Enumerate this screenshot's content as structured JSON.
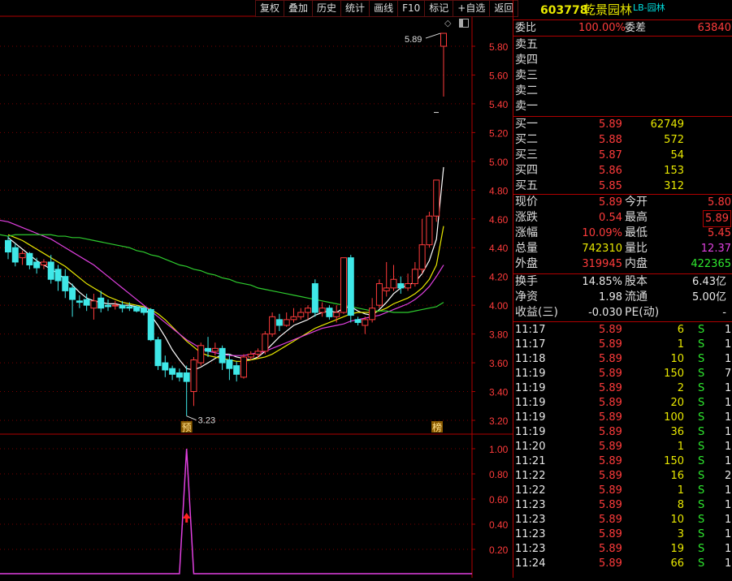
{
  "toolbar": [
    "复权",
    "叠加",
    "历史",
    "统计",
    "画线",
    "F10",
    "标记",
    "+自选",
    "返回"
  ],
  "chart_data": {
    "type": "candlestick",
    "price_axis": {
      "ticks": [
        "5.80",
        "5.60",
        "5.40",
        "5.20",
        "5.00",
        "4.80",
        "4.60",
        "4.40",
        "4.20",
        "4.00",
        "3.80",
        "3.60",
        "3.40",
        "3.20"
      ]
    },
    "indicator_axis": {
      "ticks": [
        "1.00",
        "0.80",
        "0.60",
        "0.40",
        "0.20"
      ]
    },
    "high_label": "5.89",
    "low_label": "3.23",
    "marker_left": "预",
    "marker_right": "榜",
    "candles": [
      {
        "o": 4.45,
        "c": 4.37,
        "h": 4.48,
        "l": 4.32
      },
      {
        "o": 4.4,
        "c": 4.3,
        "h": 4.43,
        "l": 4.27
      },
      {
        "o": 4.33,
        "c": 4.36,
        "h": 4.38,
        "l": 4.28
      },
      {
        "o": 4.36,
        "c": 4.28,
        "h": 4.37,
        "l": 4.25
      },
      {
        "o": 4.3,
        "c": 4.26,
        "h": 4.33,
        "l": 4.22
      },
      {
        "o": 4.28,
        "c": 4.3,
        "h": 4.32,
        "l": 4.25
      },
      {
        "o": 4.3,
        "c": 4.18,
        "h": 4.35,
        "l": 4.15
      },
      {
        "o": 4.25,
        "c": 4.17,
        "h": 4.28,
        "l": 4.1
      },
      {
        "o": 4.2,
        "c": 4.1,
        "h": 4.25,
        "l": 4.05
      },
      {
        "o": 4.12,
        "c": 4.04,
        "h": 4.15,
        "l": 3.92
      },
      {
        "o": 4.03,
        "c": 4.02,
        "h": 4.07,
        "l": 3.98
      },
      {
        "o": 4.04,
        "c": 4.0,
        "h": 4.08,
        "l": 3.96
      },
      {
        "o": 3.98,
        "c": 4.03,
        "h": 4.08,
        "l": 3.9
      },
      {
        "o": 4.05,
        "c": 3.98,
        "h": 4.1,
        "l": 3.95
      },
      {
        "o": 4.0,
        "c": 3.99,
        "h": 4.04,
        "l": 3.96
      },
      {
        "o": 4.0,
        "c": 4.0,
        "h": 4.03,
        "l": 3.97
      },
      {
        "o": 4.0,
        "c": 3.98,
        "h": 4.03,
        "l": 3.95
      },
      {
        "o": 3.99,
        "c": 3.98,
        "h": 4.02,
        "l": 3.96
      },
      {
        "o": 3.99,
        "c": 3.96,
        "h": 4.0,
        "l": 3.95
      },
      {
        "o": 3.98,
        "c": 3.95,
        "h": 3.99,
        "l": 3.93
      },
      {
        "o": 3.97,
        "c": 3.76,
        "h": 3.98,
        "l": 3.75
      },
      {
        "o": 3.76,
        "c": 3.58,
        "h": 3.78,
        "l": 3.55
      },
      {
        "o": 3.6,
        "c": 3.55,
        "h": 3.65,
        "l": 3.5
      },
      {
        "o": 3.56,
        "c": 3.52,
        "h": 3.58,
        "l": 3.48
      },
      {
        "o": 3.53,
        "c": 3.5,
        "h": 3.56,
        "l": 3.47
      },
      {
        "o": 3.53,
        "c": 3.47,
        "h": 3.58,
        "l": 3.23
      },
      {
        "o": 3.4,
        "c": 3.62,
        "h": 3.64,
        "l": 3.3
      },
      {
        "o": 3.6,
        "c": 3.72,
        "h": 3.74,
        "l": 3.58
      },
      {
        "o": 3.7,
        "c": 3.68,
        "h": 3.78,
        "l": 3.64
      },
      {
        "o": 3.68,
        "c": 3.7,
        "h": 3.74,
        "l": 3.65
      },
      {
        "o": 3.7,
        "c": 3.6,
        "h": 3.72,
        "l": 3.55
      },
      {
        "o": 3.62,
        "c": 3.56,
        "h": 3.66,
        "l": 3.48
      },
      {
        "o": 3.58,
        "c": 3.52,
        "h": 3.61,
        "l": 3.47
      },
      {
        "o": 3.5,
        "c": 3.64,
        "h": 3.66,
        "l": 3.49
      },
      {
        "o": 3.64,
        "c": 3.66,
        "h": 3.68,
        "l": 3.62
      },
      {
        "o": 3.66,
        "c": 3.68,
        "h": 3.7,
        "l": 3.63
      },
      {
        "o": 3.68,
        "c": 3.8,
        "h": 3.82,
        "l": 3.66
      },
      {
        "o": 3.8,
        "c": 3.92,
        "h": 3.95,
        "l": 3.78
      },
      {
        "o": 3.9,
        "c": 3.86,
        "h": 3.94,
        "l": 3.82
      },
      {
        "o": 3.86,
        "c": 3.9,
        "h": 3.95,
        "l": 3.85
      },
      {
        "o": 3.9,
        "c": 3.92,
        "h": 3.98,
        "l": 3.88
      },
      {
        "o": 3.92,
        "c": 3.95,
        "h": 3.98,
        "l": 3.9
      },
      {
        "o": 3.95,
        "c": 3.98,
        "h": 4.0,
        "l": 3.9
      },
      {
        "o": 4.15,
        "c": 3.95,
        "h": 4.18,
        "l": 3.92
      },
      {
        "o": 3.95,
        "c": 3.98,
        "h": 4.02,
        "l": 3.92
      },
      {
        "o": 3.98,
        "c": 3.92,
        "h": 4.0,
        "l": 3.9
      },
      {
        "o": 3.92,
        "c": 3.95,
        "h": 4.0,
        "l": 3.88
      },
      {
        "o": 3.95,
        "c": 4.33,
        "h": 4.33,
        "l": 3.94
      },
      {
        "o": 4.33,
        "c": 3.93,
        "h": 4.35,
        "l": 3.88
      },
      {
        "o": 3.9,
        "c": 3.88,
        "h": 3.92,
        "l": 3.86
      },
      {
        "o": 3.86,
        "c": 3.9,
        "h": 3.92,
        "l": 3.8
      },
      {
        "o": 3.9,
        "c": 3.98,
        "h": 4.05,
        "l": 3.88
      },
      {
        "o": 4.0,
        "c": 4.15,
        "h": 4.18,
        "l": 3.98
      },
      {
        "o": 4.1,
        "c": 4.12,
        "h": 4.3,
        "l": 4.06
      },
      {
        "o": 4.12,
        "c": 4.18,
        "h": 4.28,
        "l": 4.1
      },
      {
        "o": 4.15,
        "c": 4.12,
        "h": 4.2,
        "l": 4.08
      },
      {
        "o": 4.12,
        "c": 4.15,
        "h": 4.22,
        "l": 4.1
      },
      {
        "o": 4.15,
        "c": 4.25,
        "h": 4.3,
        "l": 4.13
      },
      {
        "o": 4.25,
        "c": 4.42,
        "h": 4.6,
        "l": 4.22
      },
      {
        "o": 4.42,
        "c": 4.62,
        "h": 4.65,
        "l": 4.4
      },
      {
        "o": 4.62,
        "c": 4.87,
        "h": 4.87,
        "l": 4.58
      },
      {
        "o": 5.8,
        "c": 5.89,
        "h": 5.89,
        "l": 5.45
      }
    ],
    "ma_series": [
      {
        "color": "#ffffff",
        "values": [
          4.47,
          4.43,
          4.39,
          4.35,
          4.31,
          4.28,
          4.25,
          4.22,
          4.18,
          4.14,
          4.09,
          4.05,
          4.03,
          4.02,
          4.01,
          4.01,
          4.0,
          4.0,
          3.99,
          3.98,
          3.93,
          3.86,
          3.78,
          3.69,
          3.62,
          3.56,
          3.55,
          3.57,
          3.6,
          3.63,
          3.66,
          3.66,
          3.64,
          3.63,
          3.62,
          3.64,
          3.68,
          3.73,
          3.78,
          3.82,
          3.86,
          3.88,
          3.9,
          3.93,
          3.95,
          3.96,
          3.95,
          3.98,
          3.99,
          3.96,
          3.94,
          3.93,
          3.97,
          4.02,
          4.08,
          4.12,
          4.14,
          4.16,
          4.22,
          4.31,
          4.46,
          4.96
        ]
      },
      {
        "color": "#e8e800",
        "values": [
          4.49,
          4.47,
          4.45,
          4.42,
          4.39,
          4.36,
          4.33,
          4.3,
          4.27,
          4.23,
          4.19,
          4.15,
          4.12,
          4.09,
          4.06,
          4.04,
          4.02,
          4.01,
          4.0,
          3.99,
          3.97,
          3.94,
          3.9,
          3.85,
          3.8,
          3.75,
          3.71,
          3.67,
          3.65,
          3.64,
          3.63,
          3.62,
          3.61,
          3.61,
          3.62,
          3.63,
          3.64,
          3.66,
          3.69,
          3.72,
          3.75,
          3.78,
          3.81,
          3.84,
          3.86,
          3.88,
          3.9,
          3.92,
          3.94,
          3.95,
          3.95,
          3.95,
          3.96,
          3.98,
          4.01,
          4.03,
          4.05,
          4.08,
          4.12,
          4.18,
          4.28,
          4.55
        ]
      },
      {
        "color": "#e040e0",
        "values": [
          4.58,
          4.56,
          4.54,
          4.52,
          4.5,
          4.48,
          4.46,
          4.43,
          4.4,
          4.37,
          4.34,
          4.31,
          4.28,
          4.24,
          4.2,
          4.16,
          4.12,
          4.08,
          4.04,
          4.0,
          3.96,
          3.92,
          3.88,
          3.84,
          3.8,
          3.76,
          3.73,
          3.7,
          3.68,
          3.67,
          3.66,
          3.65,
          3.65,
          3.65,
          3.66,
          3.67,
          3.68,
          3.7,
          3.72,
          3.74,
          3.76,
          3.78,
          3.8,
          3.82,
          3.84,
          3.85,
          3.86,
          3.87,
          3.89,
          3.9,
          3.91,
          3.92,
          3.93,
          3.95,
          3.97,
          3.99,
          4.01,
          4.04,
          4.08,
          4.13,
          4.2,
          4.28
        ]
      },
      {
        "color": "#2ecc2e",
        "values": [
          4.48,
          4.49,
          4.49,
          4.49,
          4.49,
          4.49,
          4.49,
          4.48,
          4.48,
          4.47,
          4.47,
          4.46,
          4.45,
          4.44,
          4.43,
          4.42,
          4.41,
          4.4,
          4.38,
          4.37,
          4.35,
          4.34,
          4.32,
          4.3,
          4.28,
          4.27,
          4.25,
          4.24,
          4.22,
          4.21,
          4.19,
          4.18,
          4.16,
          4.15,
          4.14,
          4.12,
          4.11,
          4.1,
          4.09,
          4.08,
          4.07,
          4.06,
          4.05,
          4.04,
          4.03,
          4.02,
          4.01,
          4.0,
          3.99,
          3.98,
          3.97,
          3.96,
          3.96,
          3.96,
          3.95,
          3.95,
          3.95,
          3.96,
          3.97,
          3.98,
          3.99,
          4.02
        ]
      }
    ],
    "indicator": {
      "color": "#e040e0",
      "values": [
        0,
        0,
        0,
        0,
        0,
        0,
        0,
        0,
        0,
        0,
        0,
        0,
        0,
        0,
        0,
        0,
        0,
        0,
        0,
        0,
        0,
        0,
        0,
        0,
        0,
        1.0,
        0,
        0,
        0,
        0,
        0,
        0,
        0,
        0,
        0,
        0,
        0,
        0,
        0,
        0,
        0,
        0,
        0,
        0,
        0,
        0,
        0,
        0,
        0,
        0,
        0,
        0,
        0,
        0,
        0,
        0,
        0,
        0,
        0,
        0,
        0,
        0
      ]
    }
  },
  "stock": {
    "code": "603778",
    "name": "乾景园林",
    "tag": "LB-园林"
  },
  "weibi": {
    "label": "委比",
    "value": "100.00%",
    "diff_label": "委差",
    "diff_value": "63840"
  },
  "sell": [
    {
      "label": "卖五",
      "price": "",
      "vol": ""
    },
    {
      "label": "卖四",
      "price": "",
      "vol": ""
    },
    {
      "label": "卖三",
      "price": "",
      "vol": ""
    },
    {
      "label": "卖二",
      "price": "",
      "vol": ""
    },
    {
      "label": "卖一",
      "price": "",
      "vol": ""
    }
  ],
  "buy": [
    {
      "label": "买一",
      "price": "5.89",
      "vol": "62749"
    },
    {
      "label": "买二",
      "price": "5.88",
      "vol": "572"
    },
    {
      "label": "买三",
      "price": "5.87",
      "vol": "54"
    },
    {
      "label": "买四",
      "price": "5.86",
      "vol": "153"
    },
    {
      "label": "买五",
      "price": "5.85",
      "vol": "312"
    }
  ],
  "quote": [
    {
      "l1": "现价",
      "v1": "5.89",
      "c1": "r",
      "l2": "今开",
      "v2": "5.80",
      "c2": "r",
      "box": false
    },
    {
      "l1": "涨跌",
      "v1": "0.54",
      "c1": "r",
      "l2": "最高",
      "v2": "5.89",
      "c2": "r",
      "box": true
    },
    {
      "l1": "涨幅",
      "v1": "10.09%",
      "c1": "r",
      "l2": "最低",
      "v2": "5.45",
      "c2": "r",
      "box": false
    },
    {
      "l1": "总量",
      "v1": "742310",
      "c1": "y",
      "l2": "量比",
      "v2": "12.37",
      "c2": "m",
      "box": false
    },
    {
      "l1": "外盘",
      "v1": "319945",
      "c1": "r",
      "l2": "内盘",
      "v2": "422365",
      "c2": "g",
      "box": false
    }
  ],
  "fund": [
    {
      "l1": "换手",
      "v1": "14.85%",
      "l2": "股本",
      "v2": "6.43亿"
    },
    {
      "l1": "净资",
      "v1": "1.98",
      "l2": "流通",
      "v2": "5.00亿"
    },
    {
      "l1": "收益(三)",
      "v1": "-0.030",
      "l2": "PE(动)",
      "v2": "-"
    }
  ],
  "ticks": [
    {
      "t": "11:17",
      "p": "5.89",
      "v": "6",
      "s": "S",
      "n": "1"
    },
    {
      "t": "11:17",
      "p": "5.89",
      "v": "1",
      "s": "S",
      "n": "1"
    },
    {
      "t": "11:18",
      "p": "5.89",
      "v": "10",
      "s": "S",
      "n": "1"
    },
    {
      "t": "11:19",
      "p": "5.89",
      "v": "150",
      "s": "S",
      "n": "7"
    },
    {
      "t": "11:19",
      "p": "5.89",
      "v": "2",
      "s": "S",
      "n": "1"
    },
    {
      "t": "11:19",
      "p": "5.89",
      "v": "20",
      "s": "S",
      "n": "1"
    },
    {
      "t": "11:19",
      "p": "5.89",
      "v": "100",
      "s": "S",
      "n": "1"
    },
    {
      "t": "11:19",
      "p": "5.89",
      "v": "36",
      "s": "S",
      "n": "1"
    },
    {
      "t": "11:20",
      "p": "5.89",
      "v": "1",
      "s": "S",
      "n": "1"
    },
    {
      "t": "11:21",
      "p": "5.89",
      "v": "150",
      "s": "S",
      "n": "1"
    },
    {
      "t": "11:22",
      "p": "5.89",
      "v": "16",
      "s": "S",
      "n": "2"
    },
    {
      "t": "11:22",
      "p": "5.89",
      "v": "1",
      "s": "S",
      "n": "1"
    },
    {
      "t": "11:23",
      "p": "5.89",
      "v": "8",
      "s": "S",
      "n": "1"
    },
    {
      "t": "11:23",
      "p": "5.89",
      "v": "10",
      "s": "S",
      "n": "1"
    },
    {
      "t": "11:23",
      "p": "5.89",
      "v": "3",
      "s": "S",
      "n": "1"
    },
    {
      "t": "11:23",
      "p": "5.89",
      "v": "19",
      "s": "S",
      "n": "1"
    },
    {
      "t": "11:24",
      "p": "5.89",
      "v": "66",
      "s": "S",
      "n": "1"
    }
  ],
  "icons": {
    "diamond": "diamond-icon",
    "window": "window-icon"
  }
}
